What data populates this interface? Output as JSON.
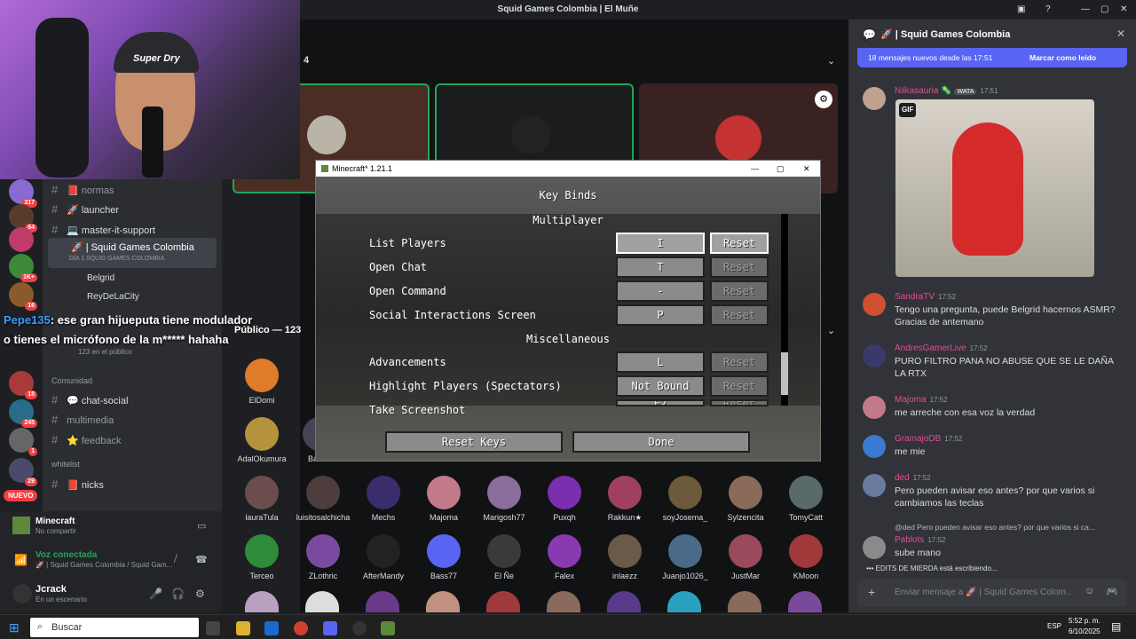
{
  "window_title": "Squid Games Colombia | El Muñe",
  "voice_count": "4",
  "channels": {
    "items": [
      {
        "label": "normas"
      },
      {
        "label": "launcher"
      },
      {
        "label": "master-it-support"
      },
      {
        "label": "Squid Games Colombia"
      },
      {
        "label": "DÍA 1 SQUID GAMES COLOMBIA"
      },
      {
        "label": "Belgrid"
      },
      {
        "label": "ReyDeLaCity"
      }
    ],
    "public_label": "Público — 123",
    "audience_label": "123 en el público",
    "community_header": "Comunidad",
    "community_items": [
      {
        "label": "chat-social"
      },
      {
        "label": "multimedia"
      },
      {
        "label": "feedback"
      }
    ],
    "whitelist_header": "whitelist",
    "whitelist_items": [
      {
        "label": "nicks"
      }
    ]
  },
  "server_badges": [
    "317",
    "64",
    "1K+",
    "16",
    "18",
    "245",
    "1",
    "29"
  ],
  "new_badge": "NUEVO",
  "overlay_chat": {
    "user": "Pepe135",
    "text": ": ese gran hijueputa tiene modulador o tienes el micrófono de la m***** hahaha"
  },
  "activity": {
    "title": "Minecraft",
    "subtitle": "No compartir"
  },
  "voice": {
    "status": "Voz conectada",
    "channel": "Squid Games Colombia / Squid Gam..."
  },
  "user": {
    "name": "Jcrack",
    "status": "En un escenario"
  },
  "minecraft": {
    "window_title": "Minecraft* 1.21.1",
    "screen_title": "Key Binds",
    "section_multiplayer": "Multiplayer",
    "section_misc": "Miscellaneous",
    "rows": [
      {
        "label": "List Players",
        "key": "I",
        "reset": "Reset"
      },
      {
        "label": "Open Chat",
        "key": "T",
        "reset": "Reset"
      },
      {
        "label": "Open Command",
        "key": "-",
        "reset": "Reset"
      },
      {
        "label": "Social Interactions Screen",
        "key": "P",
        "reset": "Reset"
      },
      {
        "label": "Advancements",
        "key": "L",
        "reset": "Reset"
      },
      {
        "label": "Highlight Players (Spectators)",
        "key": "Not Bound",
        "reset": "Reset"
      },
      {
        "label": "Take Screenshot",
        "key": "F2",
        "reset": "Reset"
      }
    ],
    "reset_keys": "Reset Keys",
    "done": "Done"
  },
  "audience": [
    {
      "name": "ElDomi"
    },
    {
      "name": "AdalOkumura"
    },
    {
      "name": "Barc..."
    },
    {
      "name": "lauraTula"
    },
    {
      "name": "luisitosalchicha"
    },
    {
      "name": "Mechs"
    },
    {
      "name": "Majoma"
    },
    {
      "name": "Marigosh77"
    },
    {
      "name": "Puxqh"
    },
    {
      "name": "Rakkun★"
    },
    {
      "name": "soyJosema_"
    },
    {
      "name": "Sylzencita"
    },
    {
      "name": "TomyCatt"
    },
    {
      "name": "Terceo"
    },
    {
      "name": "ZLothric"
    },
    {
      "name": "AfterMandy"
    },
    {
      "name": "Bass77"
    },
    {
      "name": "El Ñe"
    },
    {
      "name": "Falex"
    },
    {
      "name": "inlaezz"
    },
    {
      "name": "Juanjo1026_"
    },
    {
      "name": "JustMar"
    },
    {
      "name": "KMoon"
    }
  ],
  "chat": {
    "channel": "Squid Games Colombia",
    "new_messages": "18 mensajes nuevos desde las 17:51",
    "mark_read": "Marcar como leído",
    "gif_label": "GIF",
    "messages": [
      {
        "user": "Niikasauria",
        "tag": "WATA",
        "time": "17:51",
        "text": "",
        "color": "#e04f8f"
      },
      {
        "user": "SandraTV",
        "time": "17:52",
        "text": "Tengo una pregunta, puede Belgrid hacernos ASMR? Gracias de antemano",
        "color": "#e04f8f"
      },
      {
        "user": "AndresGamerLive",
        "time": "17:52",
        "text": "PURO FILTRO PANA NO ABUSE QUE SE LE DAÑA LA RTX",
        "color": "#e04f8f"
      },
      {
        "user": "Majoma",
        "time": "17:52",
        "text": "me arreche con esa voz la verdad",
        "color": "#e04f8f"
      },
      {
        "user": "GramajoDB",
        "time": "17:52",
        "text": "me mie",
        "color": "#e04f8f"
      },
      {
        "user": "ded",
        "time": "17:52",
        "text": "Pero pueden avisar eso antes? por que varios si cambiamos las teclas",
        "color": "#e04f8f"
      },
      {
        "user": "Pablots",
        "time": "17:52",
        "text": "sube mano",
        "color": "#e04f8f",
        "reply": "@ded Pero pueden avisar eso antes? por que varios si ca..."
      }
    ],
    "typing": "EDITS DE MIERDA está escribiendo...",
    "input_placeholder": "Enviar mensaje a 🚀 | Squid Games Colom..."
  },
  "taskbar": {
    "search": "Buscar",
    "lang": "ESP",
    "time": "5:52 p. m.",
    "date": "6/10/2025"
  }
}
